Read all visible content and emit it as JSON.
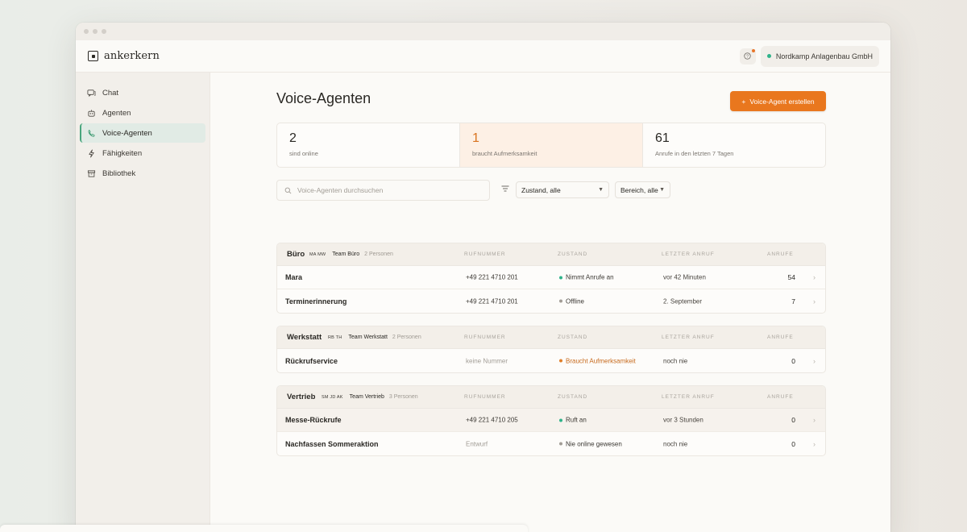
{
  "app": {
    "brand": "ankerkern",
    "org": "Nordkamp Anlagenbau GmbH"
  },
  "sidebar": {
    "items": [
      {
        "label": "Chat",
        "icon": "chat-icon"
      },
      {
        "label": "Agenten",
        "icon": "robot-icon"
      },
      {
        "label": "Voice-Agenten",
        "icon": "phone-icon",
        "active": true
      },
      {
        "label": "Fähigkeiten",
        "icon": "bolt-icon"
      },
      {
        "label": "Bibliothek",
        "icon": "archive-icon"
      }
    ]
  },
  "page": {
    "title": "Voice-Agenten",
    "create_label": "Voice-Agent erstellen",
    "create_icon": "+"
  },
  "stats": [
    {
      "value": "2",
      "label": "sind online"
    },
    {
      "value": "1",
      "label": "braucht Aufmerksamkeit"
    },
    {
      "value": "61",
      "label": "Anrufe in den letzten 7 Tagen"
    }
  ],
  "filters": {
    "search_placeholder": "Voice-Agenten durchsuchen",
    "state_select": "Zustand, alle",
    "area_select": "Bereich, alle"
  },
  "columns": {
    "number": "Rufnummer",
    "state": "Zustand",
    "last_call": "Letzter Anruf",
    "calls": "Anrufe"
  },
  "groups": [
    {
      "name": "Büro",
      "initials": "MA MW",
      "team": "Team Büro",
      "persons": "2 Personen",
      "rows": [
        {
          "name": "Mara",
          "number": "+49 221 4710 201",
          "state": "Nimmt Anrufe an",
          "state_color": "#2fb38a",
          "last": "vor 42 Minuten",
          "calls": "54"
        },
        {
          "name": "Terminerinnerung",
          "number": "+49 221 4710 201",
          "state": "Offline",
          "state_color": "#a29d96",
          "last": "2. September",
          "calls": "7"
        }
      ]
    },
    {
      "name": "Werkstatt",
      "initials": "RB TH",
      "team": "Team Werkstatt",
      "persons": "2 Personen",
      "rows": [
        {
          "name": "Rückrufservice",
          "number": "keine Nummer",
          "state": "Braucht Aufmerksamkeit",
          "state_color": "#e0802b",
          "last": "noch nie",
          "calls": "0"
        }
      ]
    },
    {
      "name": "Vertrieb",
      "initials": "SM JD AK",
      "team": "Team Vertrieb",
      "persons": "3 Personen",
      "rows": [
        {
          "name": "Messe-Rückrufe",
          "number": "+49 221 4710 205",
          "state": "Ruft an",
          "state_color": "#2fb38a",
          "last": "vor 3 Stunden",
          "calls": "0"
        },
        {
          "name": "Nachfassen Sommeraktion",
          "number": "Entwurf",
          "state": "Nie online gewesen",
          "state_color": "#a29d96",
          "last": "noch nie",
          "calls": "0"
        }
      ]
    }
  ]
}
